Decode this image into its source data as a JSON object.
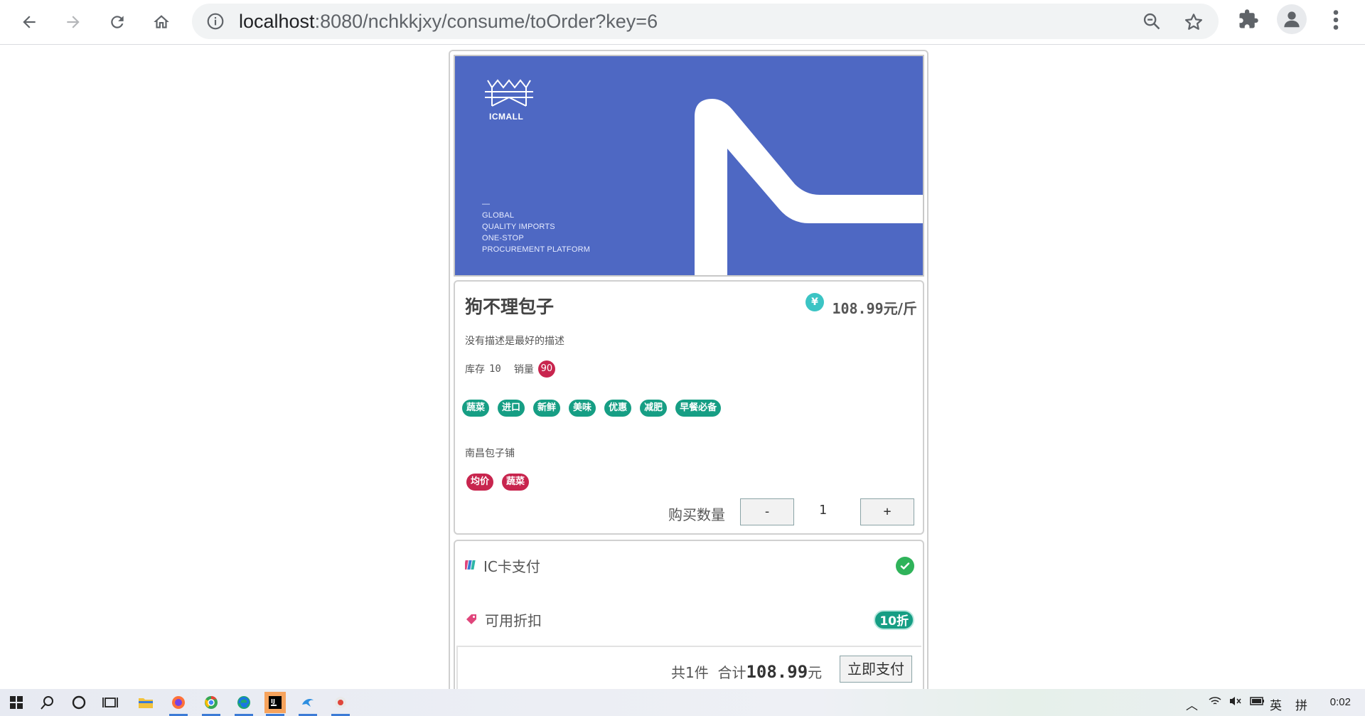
{
  "browser": {
    "url_host": "localhost",
    "url_rest": ":8080/nchkkjxy/consume/toOrder?key=6"
  },
  "banner": {
    "logo_text": "ICMALL",
    "tagline": [
      "GLOBAL",
      "QUALITY IMPORTS",
      "ONE-STOP",
      "PROCUREMENT PLATFORM"
    ]
  },
  "product": {
    "name": "狗不理包子",
    "price": "108.99",
    "price_unit": "元/斤",
    "description": "没有描述是最好的描述",
    "stock_label": "库存",
    "stock_value": "10",
    "sales_label": "销量",
    "sales_value": "90",
    "tags": [
      "蔬菜",
      "进口",
      "新鲜",
      "美味",
      "优惠",
      "减肥",
      "早餐必备"
    ],
    "shop": "南昌包子铺",
    "shop_tags": [
      "均价",
      "蔬菜"
    ],
    "quantity_label": "购买数量",
    "minus_label": "-",
    "plus_label": "+",
    "quantity": "1"
  },
  "payment": {
    "method_label": "IC卡支付",
    "discount_label": "可用折扣",
    "discount_value": "10折",
    "summary_count": "共1件",
    "summary_total_label": "合计",
    "summary_amount": "108.99",
    "summary_currency": "元",
    "pay_button": "立即支付"
  },
  "taskbar": {
    "ime": "英",
    "ime2": "拼",
    "time": "0:02"
  },
  "colors": {
    "banner_blue": "#4e68c3",
    "tag_green": "#169e84",
    "tag_red": "#c8254e",
    "check_green": "#2fb35a"
  }
}
